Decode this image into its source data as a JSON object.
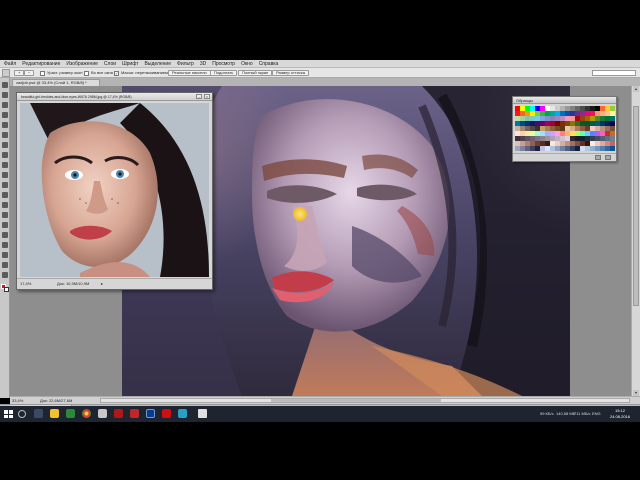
{
  "menubar": {
    "items": [
      "Файл",
      "Редактирование",
      "Изображение",
      "Слои",
      "Шрифт",
      "Выделение",
      "Фильтр",
      "3D",
      "Просмотр",
      "Окно",
      "Справка"
    ]
  },
  "options": {
    "tool_mode": "Масштаб",
    "size_label": "Ураст. размер окон",
    "all_windows_label": "Во все окна",
    "scrubby_label": "Масшт. перетаскиванием",
    "actual_pixels": "Реальные пиксели",
    "fit_screen": "Подогнать",
    "fill_screen": "Полный экран",
    "print_size": "Размер оттиска",
    "search_text": ""
  },
  "document": {
    "tab_label": "zadjob.psd @ 33,4% (Слой 1, RGB/8) *",
    "zoom": "33,4%",
    "doc_info": "Док: 22,6M/27,6M"
  },
  "reference": {
    "title": "beautiful-girl-freckles-and-blue-eyes-W576 298M.jpg @ 17,4% (RGB/8)",
    "zoom": "17,4%",
    "doc_info": "Док: 10,9M/10,9M"
  },
  "swatches": {
    "title": "Образцы",
    "colors": [
      "#ff0000",
      "#ffff00",
      "#00ff00",
      "#00ffff",
      "#0000ff",
      "#ff00ff",
      "#ffffff",
      "#e6e6e6",
      "#cccccc",
      "#b3b3b3",
      "#999999",
      "#808080",
      "#666666",
      "#4d4d4d",
      "#333333",
      "#1a1a1a",
      "#000000",
      "#ff6633",
      "#ffcc33",
      "#99cc33",
      "#ed1c24",
      "#f26522",
      "#f7941d",
      "#fff200",
      "#8dc63f",
      "#39b54a",
      "#00a651",
      "#00a99d",
      "#00aeef",
      "#0072bc",
      "#0054a6",
      "#2e3192",
      "#662d91",
      "#92278f",
      "#ec008c",
      "#ed145b",
      "#f69679",
      "#f9ad81",
      "#fdc68a",
      "#fff799",
      "#c4df9b",
      "#a3d39c",
      "#82ca9d",
      "#7accc8",
      "#6dcff6",
      "#7da7d9",
      "#8393ca",
      "#8781bd",
      "#a186be",
      "#bd8cbf",
      "#f49ac1",
      "#f5989d",
      "#9e0b0f",
      "#a0410d",
      "#a36209",
      "#aba000",
      "#598527",
      "#1a7b30",
      "#007236",
      "#00746b",
      "#0076a3",
      "#004b80",
      "#003471",
      "#1b1464",
      "#440e62",
      "#630460",
      "#9e005d",
      "#9e0039",
      "#790000",
      "#7b2e00",
      "#7d4900",
      "#827b00",
      "#406618",
      "#005e20",
      "#005826",
      "#005952",
      "#005b7f",
      "#003663",
      "#002157",
      "#0d004c",
      "#c7b299",
      "#998675",
      "#736357",
      "#534741",
      "#37302d",
      "#c69c6d",
      "#a67c52",
      "#8c6239",
      "#754c24",
      "#603913",
      "#e8c8a8",
      "#d9a88a",
      "#b27a5a",
      "#8f5a40",
      "#6a3a2a",
      "#f0d0c0",
      "#d8b0a0",
      "#b89080",
      "#987060",
      "#785040",
      "#ffe0e0",
      "#ffd0a0",
      "#ffe8a0",
      "#e0ffa0",
      "#a0ffd0",
      "#a0e0ff",
      "#a0b0ff",
      "#d0a0ff",
      "#ffa0e0",
      "#ff8080",
      "#ffb060",
      "#ffe060",
      "#b0ff60",
      "#60ffb0",
      "#60d0ff",
      "#6080ff",
      "#b060ff",
      "#ff60c0",
      "#c03030",
      "#c07020",
      "#403040",
      "#504050",
      "#605060",
      "#706070",
      "#807080",
      "#908090",
      "#a090a0",
      "#b0a0b0",
      "#c0b0c0",
      "#d0c0d0",
      "#e0d0e0",
      "#302830",
      "#201820",
      "#102030",
      "#203040",
      "#304050",
      "#405060",
      "#506070",
      "#607080",
      "#708090",
      "#e0c0b0",
      "#c8a090",
      "#b08070",
      "#906050",
      "#704030",
      "#503020",
      "#302010",
      "#f8e8d8",
      "#e8d0c0",
      "#d0b0a0",
      "#c09080",
      "#a07060",
      "#805040",
      "#603020",
      "#401000",
      "#ffe8e0",
      "#f0c8c0",
      "#e0a8a0",
      "#d08880",
      "#c06860",
      "#a0a0c0",
      "#8080a0",
      "#606080",
      "#404060",
      "#202040",
      "#c0c0e0",
      "#e0e0ff",
      "#b0c0e0",
      "#90a0c0",
      "#7080a0",
      "#506080",
      "#304060",
      "#102040",
      "#d0e0f0",
      "#b0c8e0",
      "#90b0d0",
      "#7098c0",
      "#5080b0",
      "#3068a0",
      "#105090"
    ]
  },
  "status": {
    "zoom": "33,4%",
    "doc_info": "Док: 22,6M/27,6M"
  },
  "bottom_tabs": [
    "Mini Bridge",
    "Шкала времени"
  ],
  "taskbar": {
    "tray_texts": [
      "59 КБ/с",
      "140,58 МБ",
      "711 МБ/с",
      "ENG"
    ],
    "time": "15:12",
    "date": "24.08.2016"
  },
  "icons": {
    "zoom_tool": "magnifier-icon",
    "start": "windows-start-icon"
  },
  "accent": "#c02020"
}
